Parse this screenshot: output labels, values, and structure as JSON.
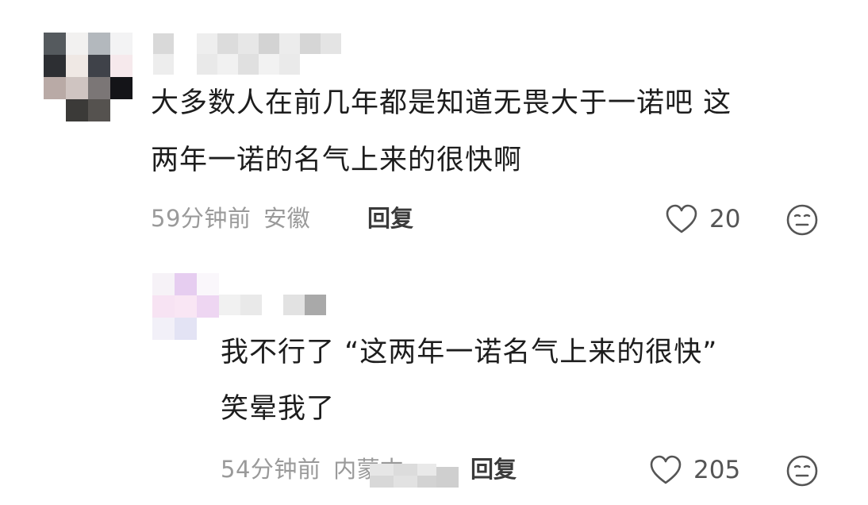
{
  "comments": [
    {
      "text_line1": "大多数人在前几年都是知道无畏大于一诺吧 这",
      "text_line2": "两年一诺的名气上来的很快啊",
      "time": "59分钟前",
      "location": "安徽",
      "reply_label": "回复",
      "likes": "20"
    },
    {
      "text_line1": "我不行了 “这两年一诺名气上来的很快”",
      "text_line2": "笑晕我了",
      "time": "54分钟前",
      "location": "内蒙古",
      "reply_label": "回复",
      "likes": "205"
    }
  ],
  "icons": {
    "like": "heart-outline-icon",
    "dislike": "meh-face-icon"
  }
}
